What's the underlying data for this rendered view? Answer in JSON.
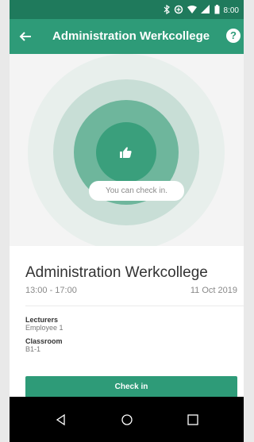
{
  "status": {
    "time": "8:00"
  },
  "appbar": {
    "title": "Administration Werkcollege",
    "help_label": "?"
  },
  "hero": {
    "message": "You can check in."
  },
  "course": {
    "title": "Administration Werkcollege",
    "time": "13:00 - 17:00",
    "date": "11 Oct 2019",
    "lecturers_label": "Lecturers",
    "lecturers_value": "Employee 1",
    "classroom_label": "Classroom",
    "classroom_value": "B1-1"
  },
  "actions": {
    "checkin_label": "Check in"
  },
  "icons": {
    "bluetooth": "bluetooth-icon",
    "data_saver": "data-saver-icon",
    "wifi": "wifi-icon",
    "signal": "signal-icon",
    "battery": "battery-icon",
    "back": "back-arrow-icon",
    "help": "help-icon",
    "thumbs_up": "thumbs-up-icon",
    "nav_back": "nav-back-icon",
    "nav_home": "nav-home-icon",
    "nav_recents": "nav-recents-icon"
  },
  "colors": {
    "primary": "#2e9b78",
    "status_bar": "#1f7a5c",
    "ring_outer": "#e8efec",
    "ring_mid": "#c8ded6",
    "ring_inner": "#6eb69c",
    "ring_center": "#3a9f7c"
  }
}
